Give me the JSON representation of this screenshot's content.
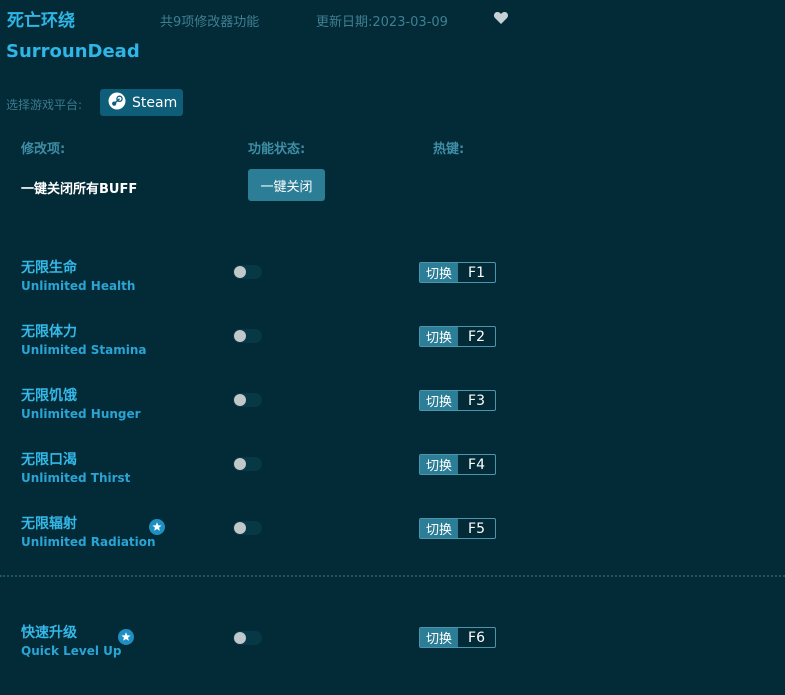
{
  "header": {
    "title_cn": "死亡环绕",
    "feature_count": "共9项修改器功能",
    "update_date": "更新日期:2023-03-09",
    "title_en": "SurrounDead"
  },
  "platform": {
    "label": "选择游戏平台:",
    "steam": "Steam"
  },
  "columns": {
    "mod": "修改项:",
    "status": "功能状态:",
    "hotkey": "热键:"
  },
  "buff": {
    "label": "一键关闭所有BUFF",
    "button": "一键关闭"
  },
  "cheats": [
    {
      "cn": "无限生命",
      "en": "Unlimited Health",
      "toggle_label": "切换",
      "key": "F1",
      "starred": false
    },
    {
      "cn": "无限体力",
      "en": "Unlimited Stamina",
      "toggle_label": "切换",
      "key": "F2",
      "starred": false
    },
    {
      "cn": "无限饥饿",
      "en": "Unlimited Hunger",
      "toggle_label": "切换",
      "key": "F3",
      "starred": false
    },
    {
      "cn": "无限口渴",
      "en": "Unlimited Thirst",
      "toggle_label": "切换",
      "key": "F4",
      "starred": false
    },
    {
      "cn": "无限辐射",
      "en": "Unlimited Radiation",
      "toggle_label": "切换",
      "key": "F5",
      "starred": true
    },
    {
      "cn": "快速升级",
      "en": "Quick Level Up",
      "toggle_label": "切换",
      "key": "F6",
      "starred": true
    }
  ],
  "colors": {
    "background": "#022a37",
    "accent": "#2fb6e6",
    "button": "#2c7d96"
  }
}
